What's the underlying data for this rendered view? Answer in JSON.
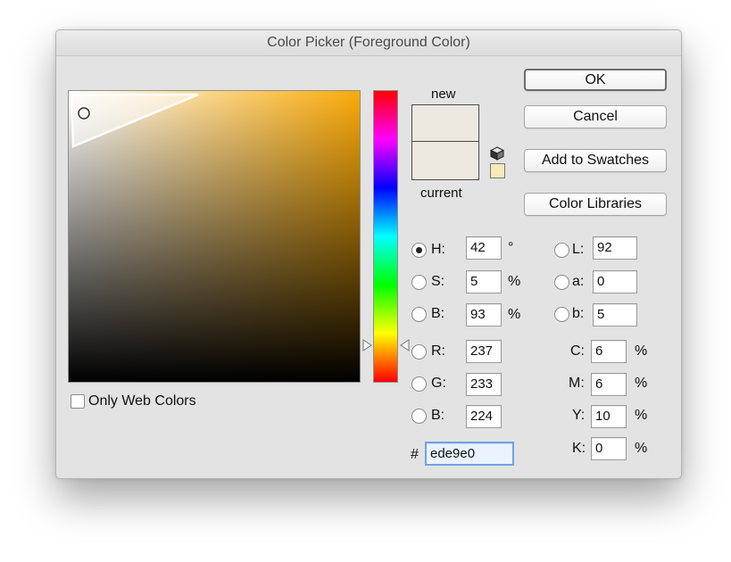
{
  "window": {
    "title": "Color Picker (Foreground Color)"
  },
  "colors": {
    "new": "#ede9e0",
    "current": "#ede9e0",
    "web_safe_warning": "#f5ebb8",
    "field_hue": "#fbab0a"
  },
  "preview": {
    "new_label": "new",
    "current_label": "current",
    "warning_icon": "cube-icon"
  },
  "buttons": {
    "ok": "OK",
    "cancel": "Cancel",
    "add_to_swatches": "Add to Swatches",
    "color_libraries": "Color Libraries"
  },
  "options": {
    "only_web_colors": "Only Web Colors",
    "only_web_colors_checked": false
  },
  "hsb": {
    "h": {
      "label": "H:",
      "value": "42",
      "unit": "°",
      "selected": true
    },
    "s": {
      "label": "S:",
      "value": "5",
      "unit": "%"
    },
    "b": {
      "label": "B:",
      "value": "93",
      "unit": "%"
    }
  },
  "rgb": {
    "r": {
      "label": "R:",
      "value": "237"
    },
    "g": {
      "label": "G:",
      "value": "233"
    },
    "b": {
      "label": "B:",
      "value": "224"
    }
  },
  "lab": {
    "l": {
      "label": "L:",
      "value": "92"
    },
    "a": {
      "label": "a:",
      "value": "0"
    },
    "b": {
      "label": "b:",
      "value": "5"
    }
  },
  "cmyk": {
    "c": {
      "label": "C:",
      "value": "6",
      "unit": "%"
    },
    "m": {
      "label": "M:",
      "value": "6",
      "unit": "%"
    },
    "y": {
      "label": "Y:",
      "value": "10",
      "unit": "%"
    },
    "k": {
      "label": "K:",
      "value": "0",
      "unit": "%"
    }
  },
  "hex": {
    "label": "#",
    "value": "ede9e0"
  }
}
